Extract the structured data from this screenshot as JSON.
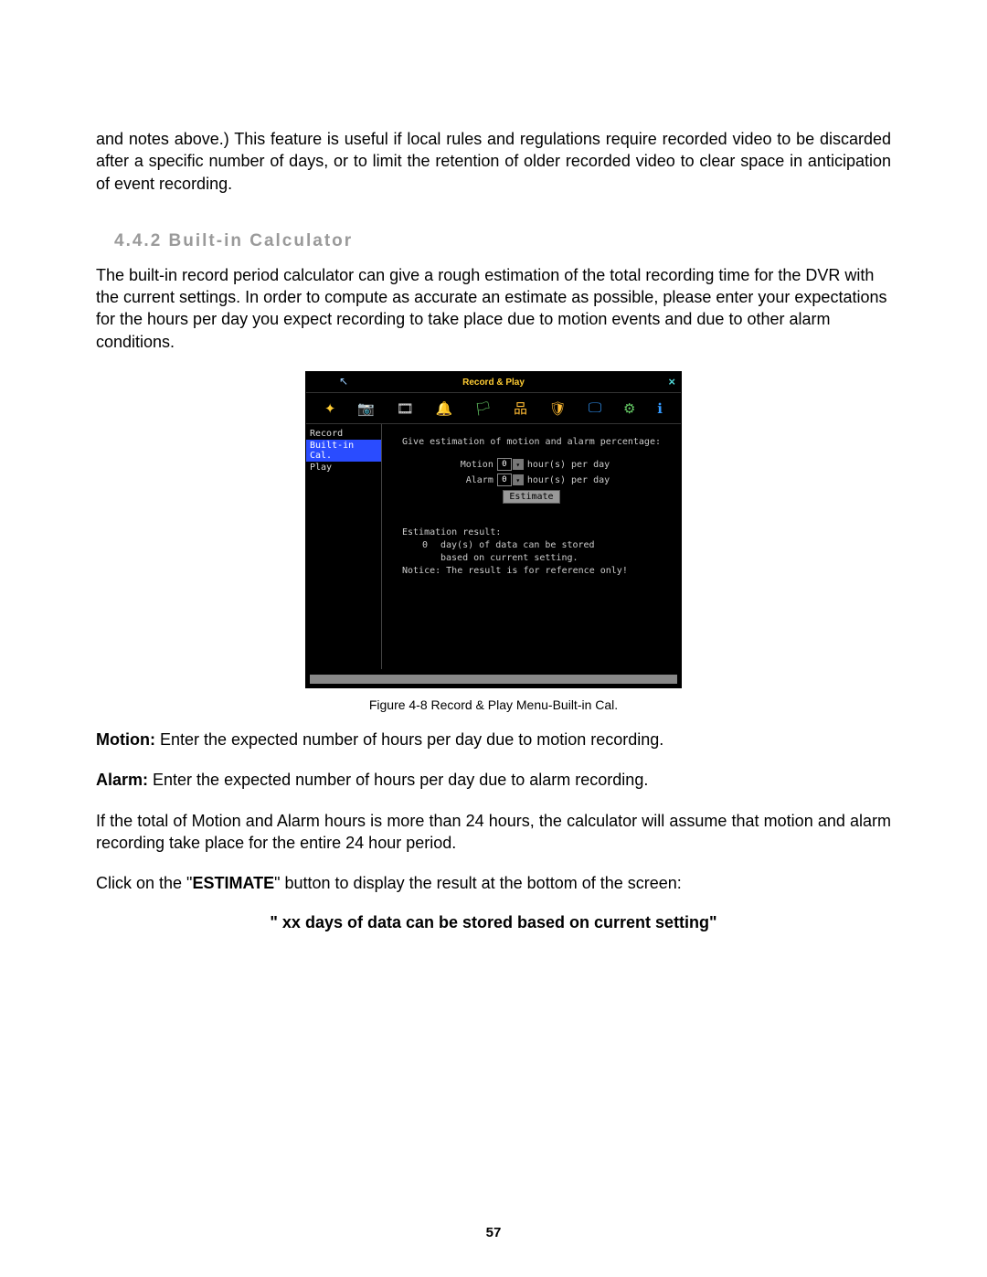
{
  "intro_para": "and notes above.) This feature is useful if local rules and regulations require recorded video to be discarded after a specific number of days, or to limit the retention of older recorded video to clear space in anticipation of event recording.",
  "section_title": "4.4.2 Built-in Calculator",
  "calc_para": "The built-in record period calculator can give a rough estimation of the total recording time for the DVR with the current settings. In order to compute as accurate an estimate as possible, please enter your expectations for the hours per day you expect recording to take place due to motion events and due to other alarm conditions.",
  "window": {
    "title": "Record & Play",
    "close": "×"
  },
  "sidebar": {
    "items": [
      "Record",
      "Built-in Cal.",
      "Play"
    ],
    "selected_index": 1
  },
  "panel": {
    "instruction": "Give estimation of motion and alarm percentage:",
    "motion_label": "Motion",
    "alarm_label": "Alarm",
    "motion_value": "0",
    "alarm_value": "0",
    "units": "hour(s) per day",
    "estimate_button": "Estimate",
    "result_header": "Estimation result:",
    "days_value": "0",
    "days_line_rest": "day(s) of data can be stored",
    "based_line": "based on current setting.",
    "notice": "Notice: The result is for reference only!"
  },
  "figure_caption": "Figure 4-8  Record & Play Menu-Built-in Cal.",
  "motion_def": {
    "label": "Motion:",
    "text": " Enter the expected number of hours per day due to motion recording."
  },
  "alarm_def": {
    "label": "Alarm:",
    "text": " Enter the expected number of hours per day due to alarm recording."
  },
  "overflow_para": "If the total of Motion and Alarm hours is more than 24 hours, the calculator will assume that motion and alarm recording take place for the entire 24 hour period.",
  "click_sentence": {
    "pre": "Click on the \"",
    "button": "ESTIMATE",
    "post": "\" button to display the result at the bottom of the screen:"
  },
  "result_quote": "\" xx days of data can be stored based on current setting\"",
  "page_number": "57"
}
